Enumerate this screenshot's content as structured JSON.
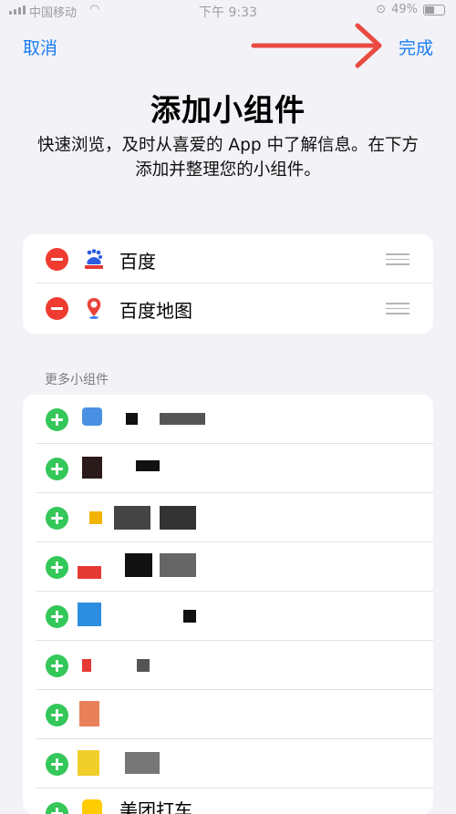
{
  "status_bar": {
    "carrier": "中国移动",
    "time": "下午 9:33",
    "battery": "49%"
  },
  "nav": {
    "cancel_label": "取消",
    "done_label": "完成"
  },
  "header": {
    "title": "添加小组件",
    "subtitle": "快速浏览，及时从喜爱的 App 中了解信息。在下方添加并整理您的小组件。"
  },
  "added_widgets": [
    {
      "label": "百度",
      "icon": "baidu-app-icon"
    },
    {
      "label": "百度地图",
      "icon": "baidu-maps-app-icon"
    }
  ],
  "more_widgets": {
    "section_label": "更多小组件",
    "visible_partial_label": "美团打车"
  },
  "colors": {
    "accent": "#1a7cf5",
    "remove": "#ef3b30",
    "add": "#34c759",
    "background": "#f2f2f7"
  }
}
